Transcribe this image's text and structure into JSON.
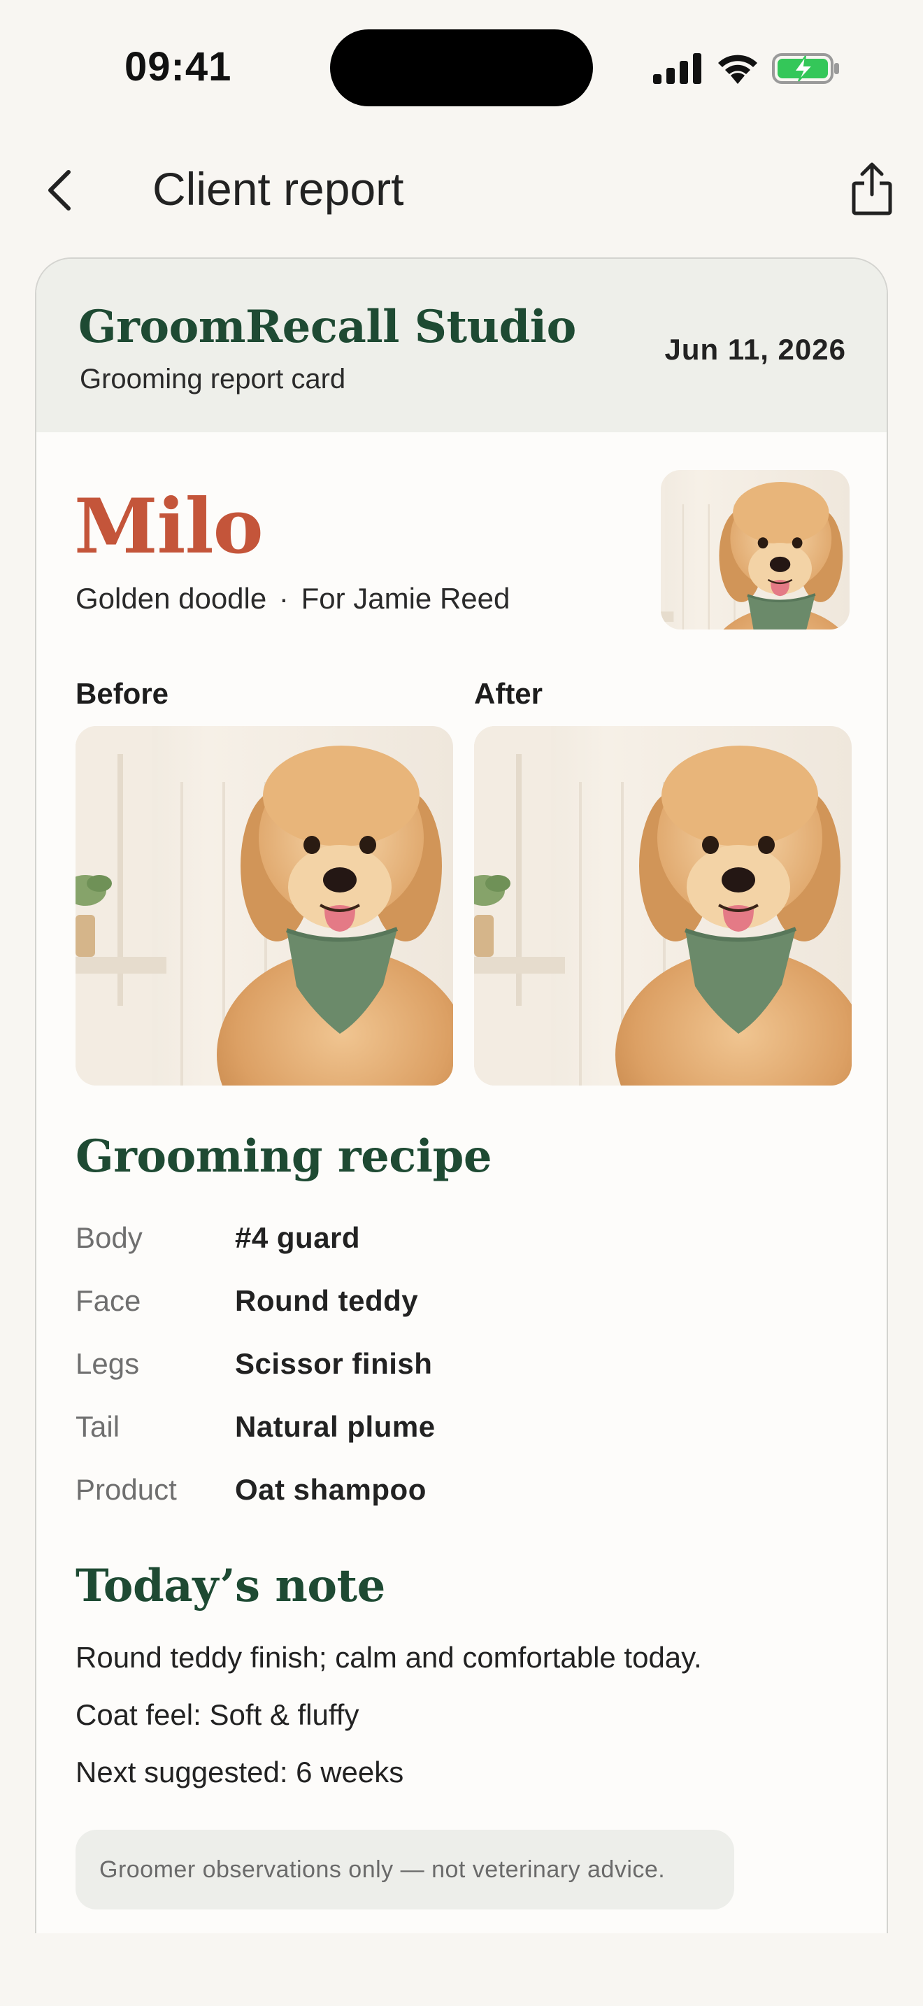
{
  "status_bar": {
    "time": "09:41"
  },
  "nav": {
    "title": "Client report"
  },
  "header": {
    "studio_name": "GroomRecall Studio",
    "subtitle": "Grooming report card",
    "date": "Jun 11, 2026"
  },
  "pet": {
    "name": "Milo",
    "breed": "Golden doodle",
    "separator": "·",
    "owner": "For Jamie Reed"
  },
  "photos": {
    "before_label": "Before",
    "after_label": "After"
  },
  "recipe": {
    "title": "Grooming recipe",
    "rows": [
      {
        "key": "Body",
        "value": "#4 guard"
      },
      {
        "key": "Face",
        "value": "Round teddy"
      },
      {
        "key": "Legs",
        "value": "Scissor finish"
      },
      {
        "key": "Tail",
        "value": "Natural plume"
      },
      {
        "key": "Product",
        "value": "Oat shampoo"
      }
    ]
  },
  "note": {
    "title": "Today’s note",
    "lines": [
      "Round teddy finish; calm and comfortable today.",
      "Coat feel: Soft & fluffy",
      "Next suggested: 6 weeks"
    ]
  },
  "disclaimer": "Groomer observations only — not veterinary advice.",
  "colors": {
    "accent_green": "#1e4a33",
    "pet_name": "#c4553a",
    "battery_green": "#34c759",
    "bandana": "#6b8a6a",
    "fur": "#d9a265"
  },
  "icons": [
    "chevron-left-icon",
    "share-icon",
    "signal-icon",
    "wifi-icon",
    "battery-charging-icon"
  ]
}
